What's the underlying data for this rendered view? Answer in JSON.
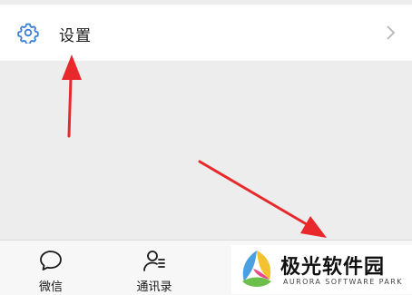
{
  "settings": {
    "label": "设置",
    "icon": "gear-icon",
    "accent": "#3b7fd6"
  },
  "tabbar": {
    "tabs": [
      {
        "label": "微信",
        "icon": "chat-bubble-icon"
      },
      {
        "label": "通讯录",
        "icon": "contacts-icon"
      }
    ]
  },
  "watermark": {
    "title": "极光软件园",
    "subtitle": "AURORA SOFTWARE PARK"
  },
  "annotations": {
    "arrow_color": "#e8282b"
  }
}
